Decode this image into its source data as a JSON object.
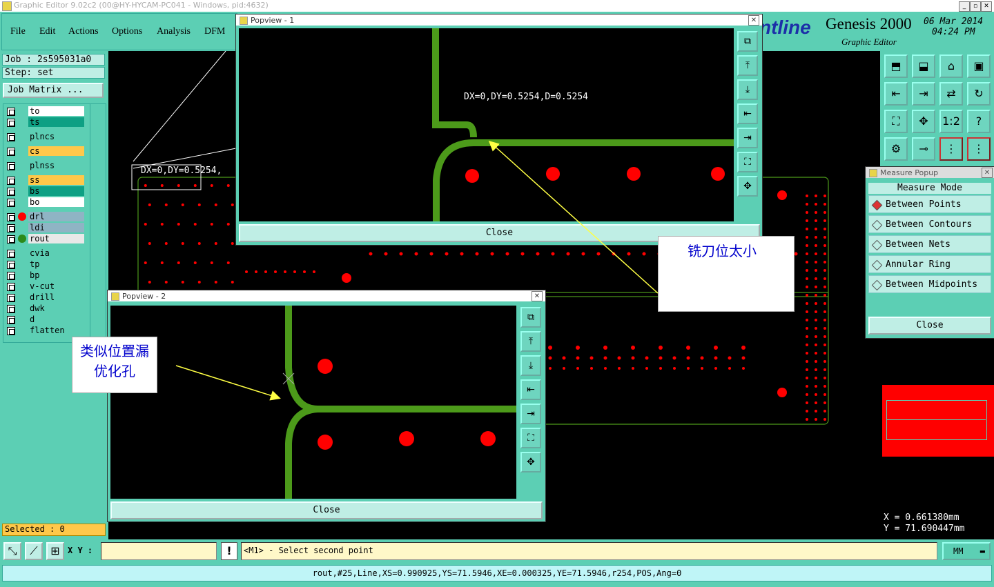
{
  "app": {
    "title": "Graphic Editor 9.02c2 (00@HY-HYCAM-PC041 - Windows, pid:4632)",
    "brand_partial": "ntline",
    "product": "Genesis 2000",
    "product_sub": "Graphic Editor",
    "date": "06 Mar 2014",
    "time": "04:24 PM"
  },
  "menu": [
    "File",
    "Edit",
    "Actions",
    "Options",
    "Analysis",
    "DFM"
  ],
  "left_panel": {
    "job": "Job : 2s595031a0",
    "step": "Step: set",
    "job_matrix_button": "Job Matrix ...",
    "layers": [
      {
        "name": "to",
        "color": "#ffffff"
      },
      {
        "name": "ts",
        "color": "#0ea084"
      },
      {
        "name": "plncs",
        "color": "#5ccfb4"
      },
      {
        "name": "cs",
        "color": "#ffc84a"
      },
      {
        "name": "plnss",
        "color": "#5ccfb4"
      },
      {
        "name": "ss",
        "color": "#ffc84a"
      },
      {
        "name": "bs",
        "color": "#0ea084"
      },
      {
        "name": "bo",
        "color": "#ffffff"
      },
      {
        "name": "drl",
        "color": "#8fb4c4"
      },
      {
        "name": "ldi",
        "color": "#8fb4c4"
      },
      {
        "name": "rout",
        "color": "#e8e8e8"
      },
      {
        "name": "cvia",
        "color": "#5ccfb4"
      },
      {
        "name": "tp",
        "color": "#5ccfb4"
      },
      {
        "name": "bp",
        "color": "#5ccfb4"
      },
      {
        "name": "v-cut",
        "color": "#5ccfb4"
      },
      {
        "name": "drill",
        "color": "#5ccfb4"
      },
      {
        "name": "dwk",
        "color": "#5ccfb4"
      },
      {
        "name": "d",
        "color": "#5ccfb4"
      },
      {
        "name": "flatten",
        "color": "#5ccfb4"
      }
    ],
    "selected": "Selected : 0"
  },
  "canvas": {
    "measure_label": "DX=0,DY=0.5254,"
  },
  "popview1": {
    "title": "Popview - 1",
    "measure": "DX=0,DY=0.5254,D=0.5254",
    "close": "Close"
  },
  "popview2": {
    "title": "Popview - 2",
    "close": "Close"
  },
  "callouts": {
    "right": "铣刀位太小",
    "left_line1": "类似位置漏",
    "left_line2": "优化孔"
  },
  "measure_popup": {
    "title": "Measure Popup",
    "mode_label": "Measure Mode",
    "options": [
      "Between Points",
      "Between Contours",
      "Between Nets",
      "Annular Ring",
      "Between Midpoints"
    ],
    "selected_index": 0,
    "close": "Close"
  },
  "right_panel": {
    "icons": [
      "zoom-home",
      "zoom-in",
      "home",
      "window-fit",
      "pan-left",
      "pan-right",
      "swap",
      "redraw",
      "fit-screen",
      "center",
      "ratio-1-1",
      "help",
      "tools",
      "net",
      "layer-a",
      "layer-b"
    ],
    "ratio_label": "1:2",
    "help_label": "?",
    "coord_x": "X = 0.661380mm",
    "coord_y": "Y = 71.690447mm"
  },
  "status": {
    "xy_label": "X Y :",
    "xy_value": "",
    "prompt": "<M1> - Select second point",
    "units": "MM",
    "info": "rout,#25,Line,XS=0.990925,YS=71.5946,XE=0.000325,YE=71.5946,r254,POS,Ang=0"
  },
  "colors": {
    "panel": "#5ccfb4",
    "rout_line": "#4c9a1a",
    "pad": "#ff0000",
    "arrow": "#ffff44"
  }
}
